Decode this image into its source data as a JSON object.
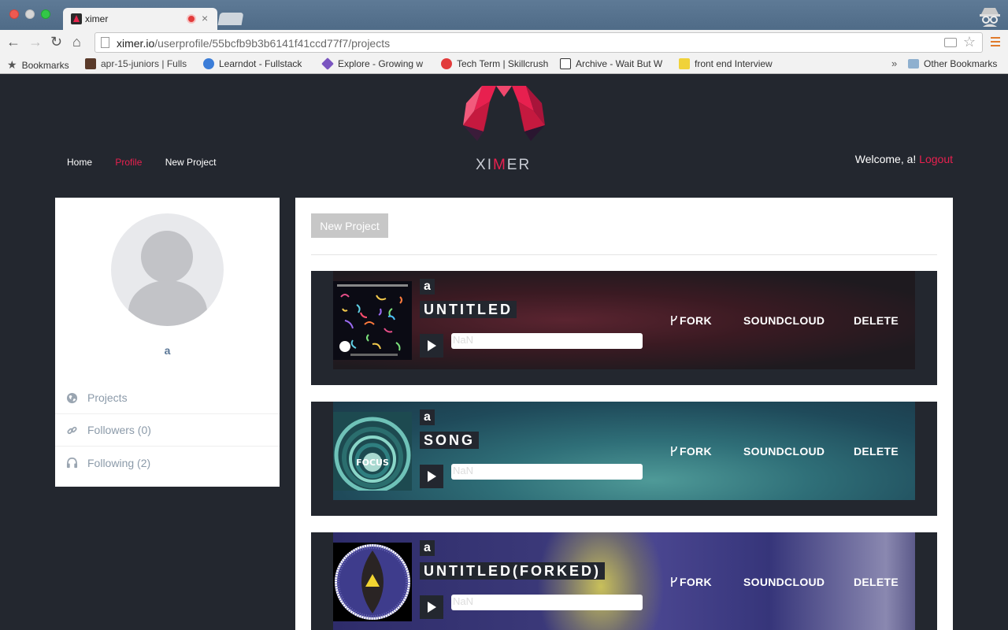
{
  "browser": {
    "tab_title": "ximer",
    "tab_close": "×",
    "url_host": "ximer.io",
    "url_path": "/userprofile/55bcfb9b3b6141f41ccd77f7/projects",
    "bookmarks": [
      {
        "label": "Bookmarks",
        "icon": "star-icon",
        "color": "#555555"
      },
      {
        "label": "apr-15-juniors | Fulls",
        "icon": "slack-icon",
        "color": "#5a3a2a"
      },
      {
        "label": "Learndot - Fullstack",
        "icon": "learndot-icon",
        "color": "#3b7dd8"
      },
      {
        "label": "Explore - Growing w",
        "icon": "explore-icon",
        "color": "#7a55c0"
      },
      {
        "label": "Tech Term | Skillcrush",
        "icon": "skillcrush-icon",
        "color": "#e23b3b"
      },
      {
        "label": "Archive - Wait But W",
        "icon": "waitbutwhy-icon",
        "color": "#333333"
      },
      {
        "label": "front end Interview",
        "icon": "js-icon",
        "color": "#f0d23a"
      }
    ],
    "more_bookmarks": "»",
    "other_bookmarks": "Other Bookmarks"
  },
  "nav": {
    "home": "Home",
    "profile": "Profile",
    "new_project": "New Project"
  },
  "brand": {
    "x": "X",
    "i": "I",
    "m": "M",
    "er": "ER"
  },
  "welcome": {
    "text": "Welcome, a!",
    "logout": "Logout"
  },
  "profile": {
    "username": "a",
    "menu": [
      {
        "label": "Projects",
        "icon": "globe-icon"
      },
      {
        "label": "Followers (0)",
        "icon": "link-icon"
      },
      {
        "label": "Following (2)",
        "icon": "headphones-icon"
      }
    ]
  },
  "main": {
    "new_project_button": "New Project",
    "projects": [
      {
        "owner": "a",
        "title": "UNTITLED",
        "progress": "NaN",
        "fork": "FORK",
        "soundcloud": "SOUNDCLOUD",
        "delete": "DELETE"
      },
      {
        "owner": "a",
        "title": "SONG",
        "progress": "NaN",
        "fork": "FORK",
        "soundcloud": "SOUNDCLOUD",
        "delete": "DELETE"
      },
      {
        "owner": "a",
        "title": "UNTITLED(FORKED)",
        "progress": "NaN",
        "fork": "FORK",
        "soundcloud": "SOUNDCLOUD",
        "delete": "DELETE"
      }
    ]
  },
  "colors": {
    "accent": "#e8204f",
    "background": "#23272f",
    "username": "#5b7797"
  }
}
